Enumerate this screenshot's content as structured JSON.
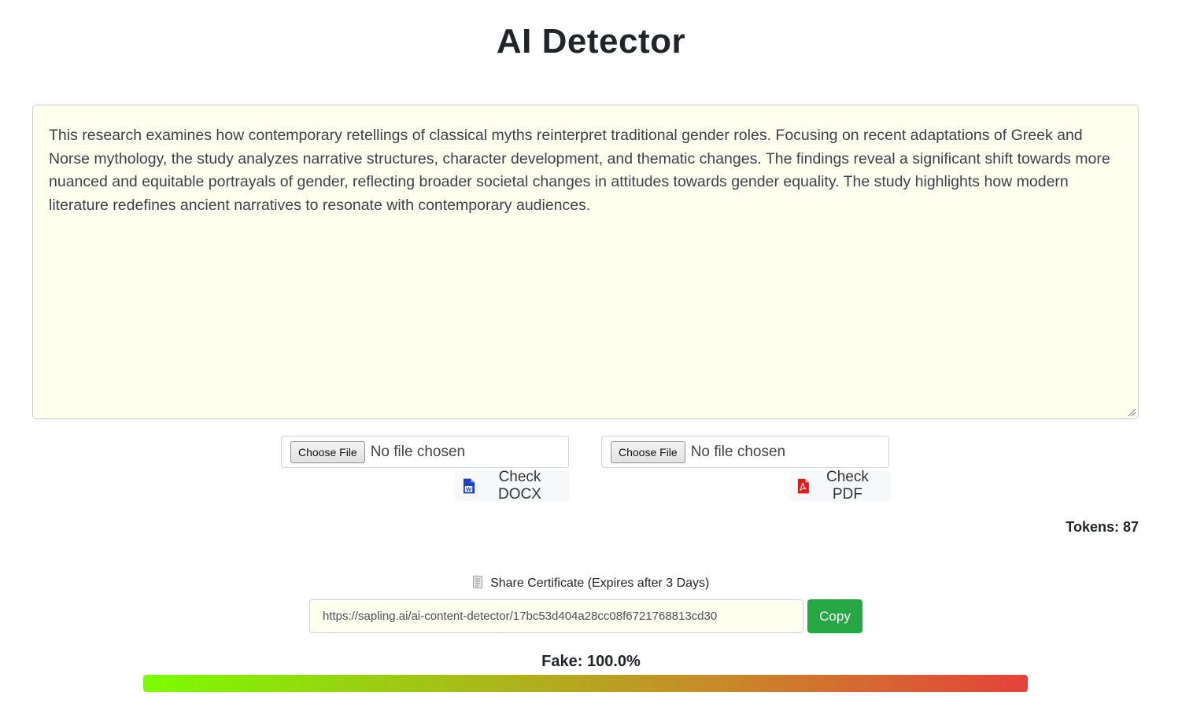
{
  "title": "AI Detector",
  "editor": {
    "text": "This research examines how contemporary retellings of classical myths reinterpret traditional gender roles. Focusing on recent adaptations of Greek and Norse mythology, the study analyzes narrative structures, character development, and thematic changes. The findings reveal a significant shift towards more nuanced and equitable portrayals of gender, reflecting broader societal changes in attitudes towards gender equality. The study highlights how modern literature redefines ancient narratives to resonate with contemporary audiences."
  },
  "upload": {
    "docx": {
      "choose_label": "Choose File",
      "status": "No file chosen",
      "check_label": "Check DOCX",
      "icon": "word-file-icon"
    },
    "pdf": {
      "choose_label": "Choose File",
      "status": "No file chosen",
      "check_label": "Check PDF",
      "icon": "pdf-file-icon"
    }
  },
  "tokens": {
    "label": "Tokens: 87"
  },
  "share": {
    "label": "Share Certificate (Expires after 3 Days)",
    "icon": "document-icon",
    "url": "https://sapling.ai/ai-content-detector/17bc53d404a28cc08f6721768813cd30",
    "copy_label": "Copy"
  },
  "result": {
    "label": "Fake: 100.0%",
    "fake_fraction": 1.0
  },
  "colors": {
    "editor_bg": "#fffff0",
    "copy_button": "#28a745",
    "bar_start": "#7cfc00",
    "bar_end": "#e5423a",
    "word_icon": "#1a3fd8",
    "pdf_icon": "#e01b1b"
  }
}
